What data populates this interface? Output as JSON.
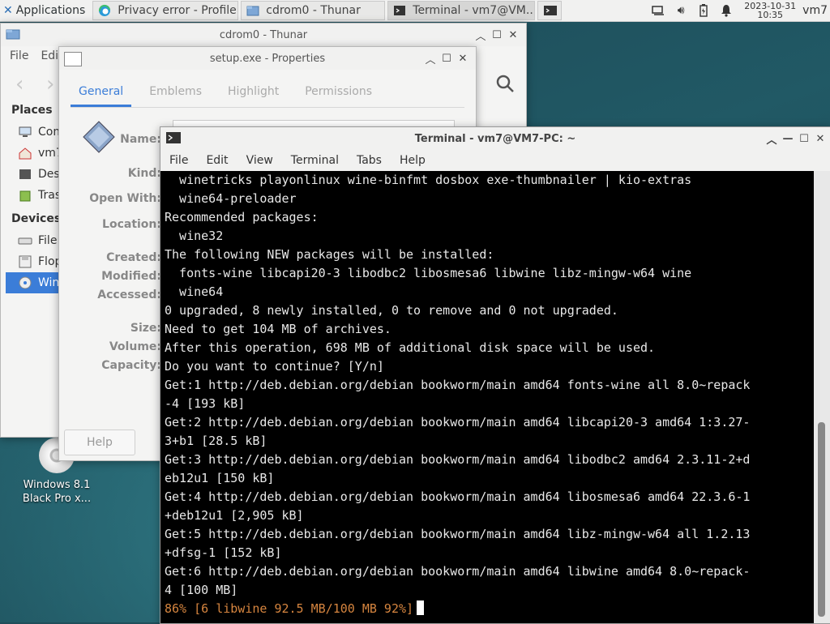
{
  "panel": {
    "applications_label": "Applications",
    "tasks": [
      {
        "label": "Privacy error - Profile...",
        "icon": "edge-browser-icon"
      },
      {
        "label": "cdrom0 - Thunar",
        "icon": "folder-icon"
      },
      {
        "label": "Terminal - vm7@VM...",
        "icon": "terminal-icon"
      }
    ],
    "clock_date": "2023-10-31",
    "clock_time": "10:35",
    "user": "vm7"
  },
  "thunar": {
    "title": "cdrom0 - Thunar",
    "menu": [
      "File",
      "Edi"
    ],
    "places_header": "Places",
    "places": [
      "Com",
      "vm7",
      "Des",
      "Tras"
    ],
    "devices_header": "Devices",
    "devices": [
      "File",
      "Flop",
      "Win"
    ]
  },
  "properties": {
    "title": "setup.exe - Properties",
    "tabs": [
      "General",
      "Emblems",
      "Highlight",
      "Permissions"
    ],
    "labels": [
      "Name:",
      "Kind:",
      "Open With:",
      "Location:",
      "Created:",
      "Modified:",
      "Accessed:",
      "Size:",
      "Volume:",
      "Capacity:"
    ],
    "help_button": "Help"
  },
  "terminal": {
    "title": "Terminal - vm7@VM7-PC: ~",
    "menu": [
      "File",
      "Edit",
      "View",
      "Terminal",
      "Tabs",
      "Help"
    ],
    "lines": [
      "  winetricks playonlinux wine-binfmt dosbox exe-thumbnailer | kio-extras",
      "  wine64-preloader",
      "Recommended packages:",
      "  wine32",
      "The following NEW packages will be installed:",
      "  fonts-wine libcapi20-3 libodbc2 libosmesa6 libwine libz-mingw-w64 wine",
      "  wine64",
      "0 upgraded, 8 newly installed, 0 to remove and 0 not upgraded.",
      "Need to get 104 MB of archives.",
      "After this operation, 698 MB of additional disk space will be used.",
      "Do you want to continue? [Y/n]",
      "Get:1 http://deb.debian.org/debian bookworm/main amd64 fonts-wine all 8.0~repack",
      "-4 [193 kB]",
      "Get:2 http://deb.debian.org/debian bookworm/main amd64 libcapi20-3 amd64 1:3.27-",
      "3+b1 [28.5 kB]",
      "Get:3 http://deb.debian.org/debian bookworm/main amd64 libodbc2 amd64 2.3.11-2+d",
      "eb12u1 [150 kB]",
      "Get:4 http://deb.debian.org/debian bookworm/main amd64 libosmesa6 amd64 22.3.6-1",
      "+deb12u1 [2,905 kB]",
      "Get:5 http://deb.debian.org/debian bookworm/main amd64 libz-mingw-w64 all 1.2.13",
      "+dfsg-1 [152 kB]",
      "Get:6 http://deb.debian.org/debian bookworm/main amd64 libwine amd64 8.0~repack-",
      "4 [100 MB]"
    ],
    "progress_line": "86% [6 libwine 92.5 MB/100 MB 92%]"
  },
  "desktop_icon": {
    "line1": "Windows 8.1",
    "line2": "Black Pro x..."
  }
}
